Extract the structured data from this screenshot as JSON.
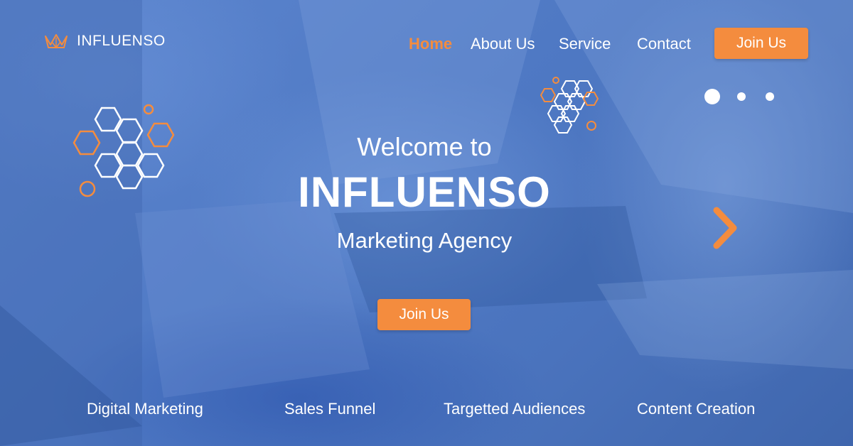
{
  "brand": {
    "name": "INFLUENSO",
    "logo_icon": "crown-lotus-icon"
  },
  "nav": {
    "items": [
      {
        "label": "Home",
        "active": true
      },
      {
        "label": "About Us",
        "active": false
      },
      {
        "label": "Service",
        "active": false
      },
      {
        "label": "Contact",
        "active": false
      }
    ],
    "join_label": "Join Us"
  },
  "hero": {
    "welcome": "Welcome to",
    "title": "INFLUENSO",
    "subtitle": "Marketing Agency",
    "cta_label": "Join Us"
  },
  "carousel": {
    "slides": 3,
    "active_index": 0,
    "next_icon": "chevron-right-icon"
  },
  "services": [
    "Digital Marketing",
    "Sales Funnel",
    "Targetted Audiences",
    "Content Creation"
  ],
  "colors": {
    "accent": "#f48c3e",
    "overlay": "#4f79c4",
    "text": "#ffffff"
  }
}
